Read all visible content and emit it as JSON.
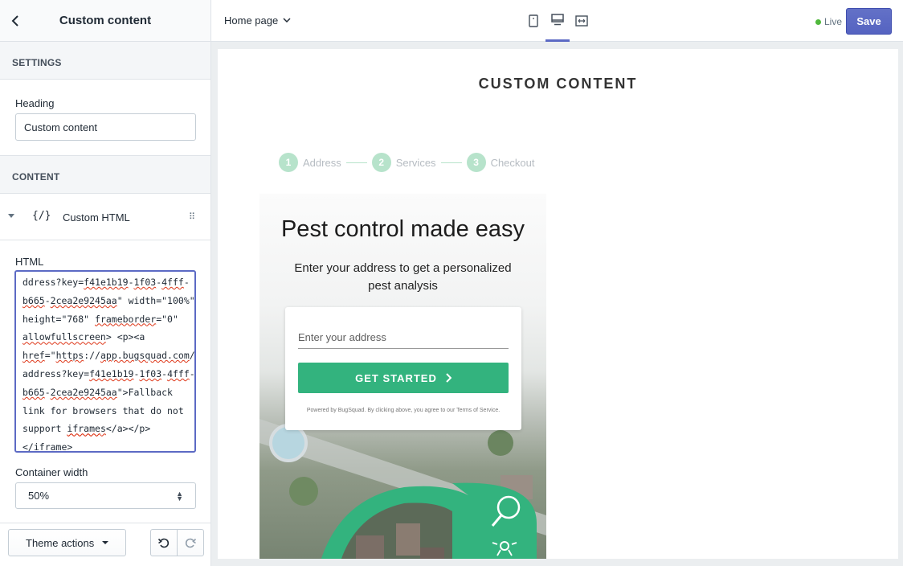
{
  "sidebar": {
    "title": "Custom content",
    "settings_header": "SETTINGS",
    "heading_label": "Heading",
    "heading_value": "Custom content",
    "content_header": "CONTENT",
    "block_icon": "{/}",
    "block_label": "Custom HTML",
    "html_label": "HTML",
    "html_lines": [
      "ddress?key=f41e1b19-1f03-4fff-",
      "b665-2cea2e9245aa\" width=\"100%\"",
      "height=\"768\" frameborder=\"0\"",
      "allowfullscreen> <p><a",
      "href=\"https://app.bugsquad.com/",
      "address?key=f41e1b19-1f03-4fff-",
      "b665-2cea2e9245aa\">Fallback",
      "link for browsers that do not",
      "support iframes</a></p>",
      "</iframe>"
    ],
    "container_width_label": "Container width",
    "container_width_value": "50%",
    "theme_actions_label": "Theme actions"
  },
  "topbar": {
    "page_label": "Home page",
    "live_label": "Live",
    "save_label": "Save",
    "view_icons": [
      "mobile-icon",
      "desktop-icon",
      "fullwidth-icon"
    ]
  },
  "preview": {
    "section_title": "CUSTOM CONTENT",
    "steps": [
      {
        "num": "1",
        "label": "Address"
      },
      {
        "num": "2",
        "label": "Services"
      },
      {
        "num": "3",
        "label": "Checkout"
      }
    ],
    "hero_title": "Pest control made easy",
    "hero_sub": "Enter your address to get a personalized pest analysis",
    "address_placeholder": "Enter your address",
    "cta_label": "GET STARTED",
    "powered_text": "Powered by BugSquad. By clicking above, you agree to our Terms of Service."
  },
  "colors": {
    "accent": "#5c6ac4",
    "brand_green": "#33b37e",
    "live_green": "#50b83c"
  }
}
